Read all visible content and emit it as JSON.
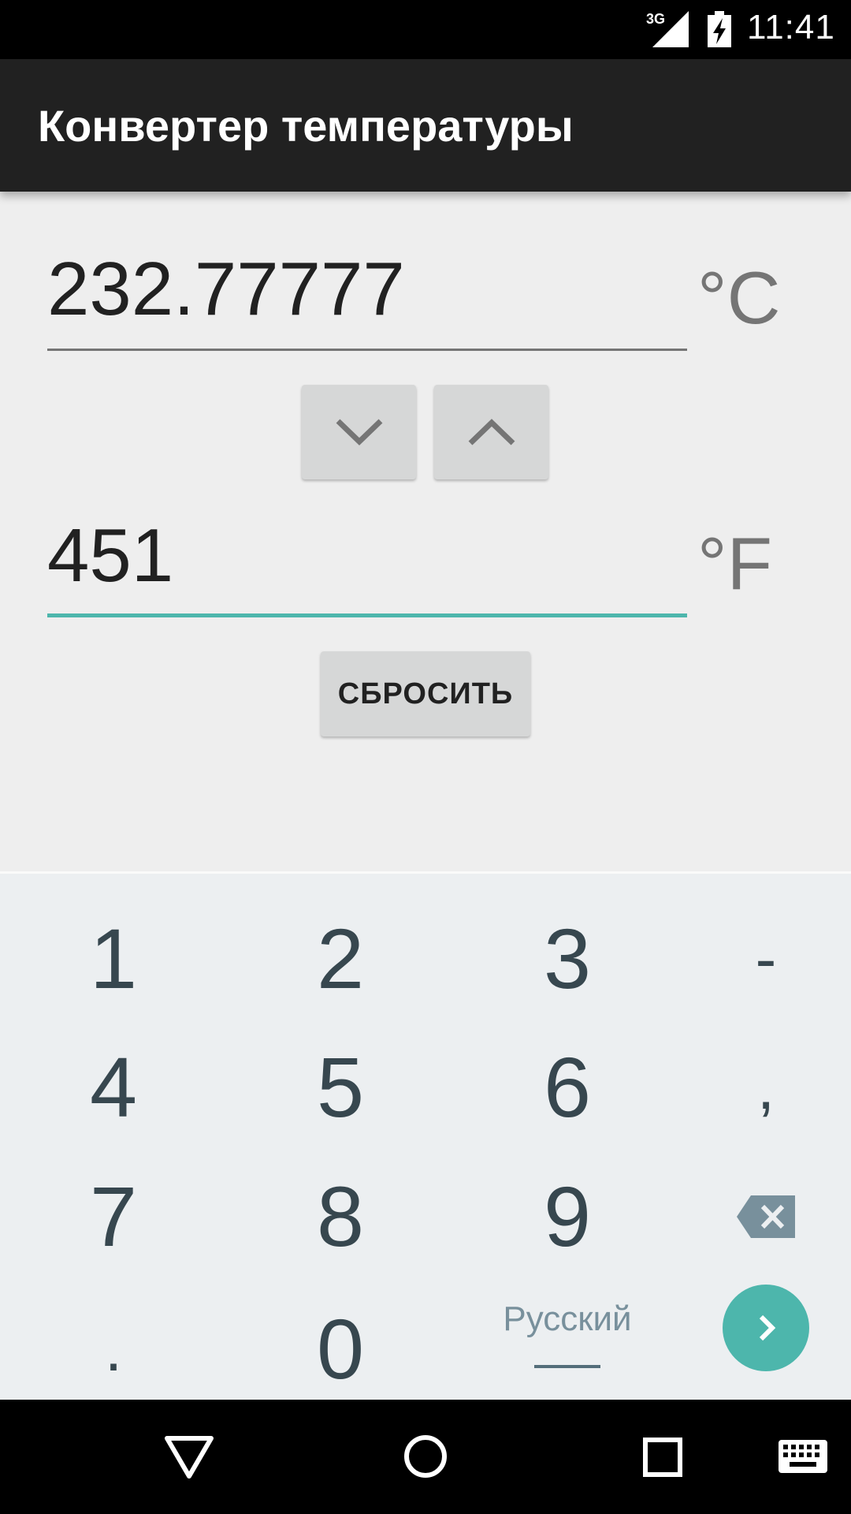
{
  "status_bar": {
    "network": "3G",
    "time": "11:41",
    "icons": [
      "signal-icon",
      "battery-charging-icon"
    ]
  },
  "app_bar": {
    "title": "Конвертер температуры"
  },
  "converter": {
    "celsius": {
      "value": "232.77777",
      "unit": "°C"
    },
    "fahrenheit": {
      "value": "451",
      "unit": "°F",
      "focused": true
    },
    "arrow_buttons": {
      "down_icon": "chevron-down-icon",
      "up_icon": "chevron-up-icon"
    },
    "reset_label": "СБРОСИТЬ",
    "accent_color": "#4db6ac"
  },
  "keyboard": {
    "rows": [
      [
        "1",
        "2",
        "3",
        "-"
      ],
      [
        "4",
        "5",
        "6",
        ","
      ],
      [
        "7",
        "8",
        "9",
        "backspace"
      ],
      [
        ".",
        "0",
        "Русский",
        "enter"
      ]
    ],
    "language_label": "Русский",
    "enter_color": "#4db6ac"
  },
  "nav_bar": {
    "icons": [
      "back-icon",
      "home-icon",
      "recents-icon",
      "keyboard-icon"
    ]
  }
}
